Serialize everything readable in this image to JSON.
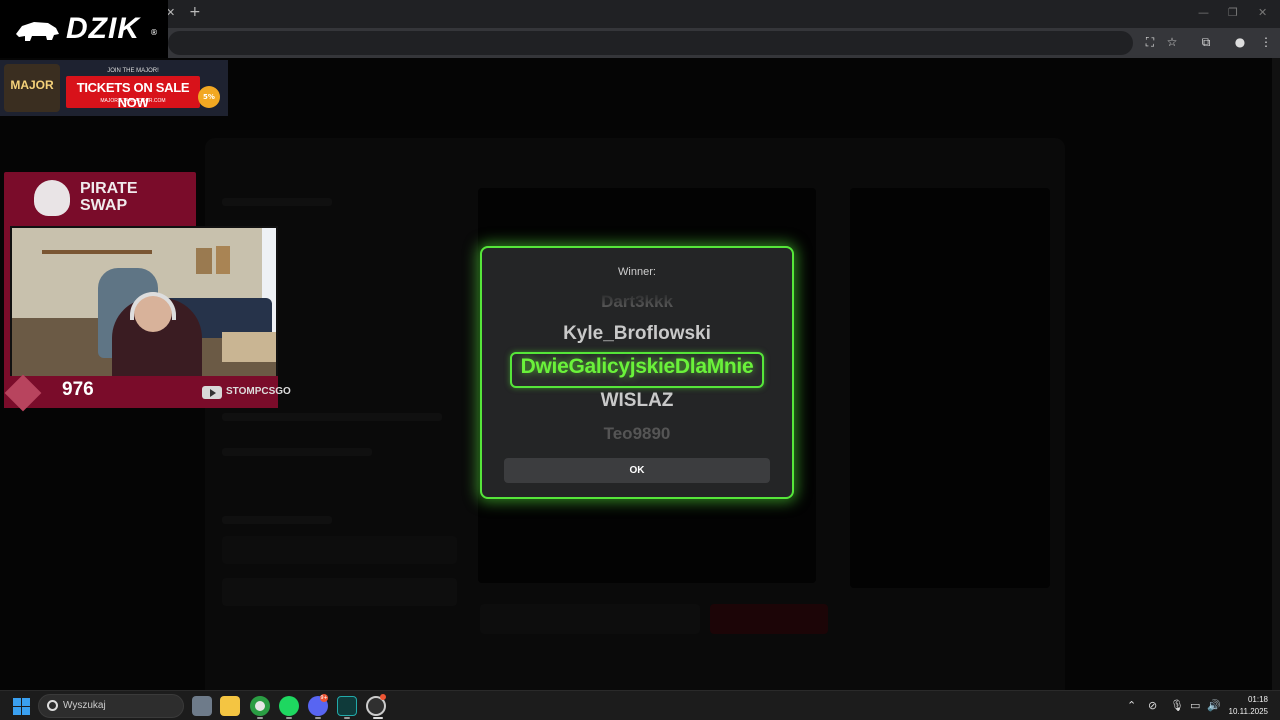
{
  "browser": {
    "tab_close_icon": "close-icon",
    "new_tab_label": "+",
    "window_controls": [
      "—",
      "❐",
      "✕"
    ]
  },
  "overlay": {
    "logo_text": "DZIK",
    "logo_mark": "®",
    "banner": {
      "join": "JOIN THE MAJOR!",
      "major": "MAJOR",
      "tickets": "TICKETS ON SALE NOW",
      "url": "MAJOR.STARLADDER.COM",
      "badge": "5%"
    },
    "sponsor": {
      "line1": "PIRATE",
      "line2": "SWAP"
    },
    "counter": "976",
    "channel": "STOMPCSGO"
  },
  "modal": {
    "title": "Winner:",
    "reel": [
      "Dart3kkk",
      "Kyle_Broflowski",
      "DwieGalicyjskieDlaMnie",
      "WISLAZ",
      "Teo9890"
    ],
    "winner": "DwieGalicyjskieDlaMnie",
    "ok_label": "OK",
    "accent_color": "#56e63a"
  },
  "taskbar": {
    "search_placeholder": "Wyszukaj",
    "apps": [
      "file-explorer",
      "folder",
      "chrome",
      "spotify",
      "discord",
      "terminal",
      "obs"
    ],
    "discord_badge": "9+",
    "clock_time": "01:18",
    "clock_date": "10.11.2025"
  }
}
